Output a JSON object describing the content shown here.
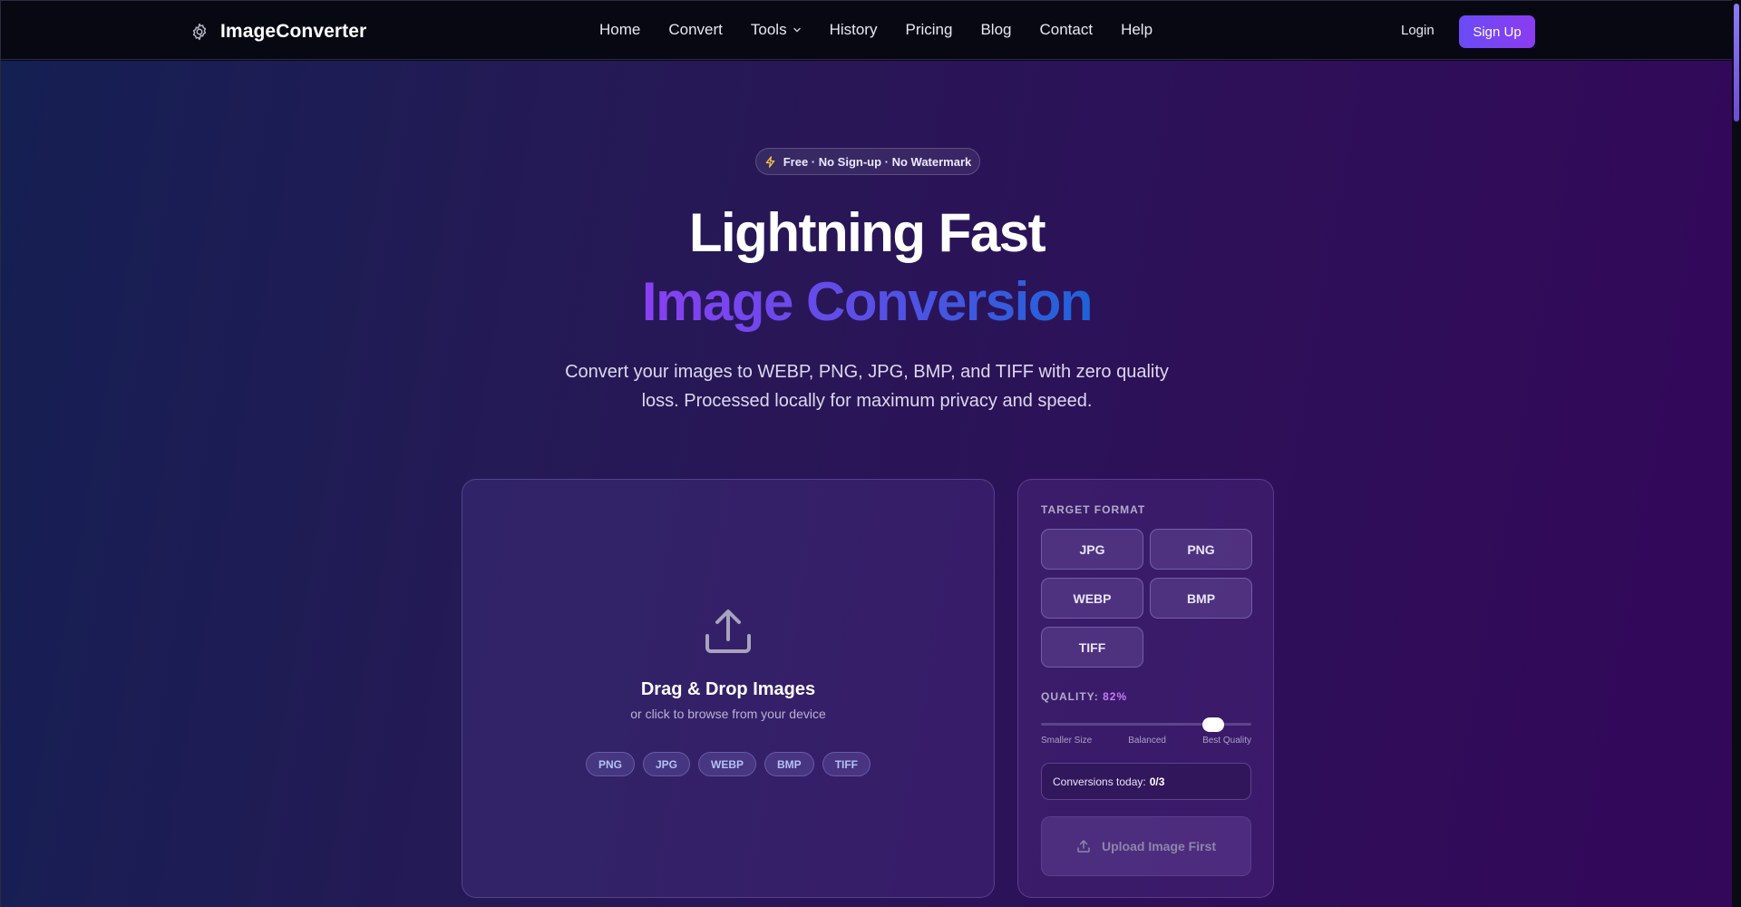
{
  "brand": {
    "name": "ImageConverter",
    "icon": "gear-icon"
  },
  "nav": {
    "links": [
      {
        "label": "Home"
      },
      {
        "label": "Convert"
      },
      {
        "label": "Tools",
        "dropdown": true
      },
      {
        "label": "History"
      },
      {
        "label": "Pricing"
      },
      {
        "label": "Blog"
      },
      {
        "label": "Contact"
      },
      {
        "label": "Help"
      }
    ],
    "login": "Login",
    "signup": "Sign Up"
  },
  "hero": {
    "badge": "Free · No Sign-up · No Watermark",
    "title_line1": "Lightning Fast",
    "title_line2": "Image Conversion",
    "subtitle": "Convert your images to WEBP, PNG, JPG, BMP, and TIFF with zero quality loss. Processed locally for maximum privacy and speed."
  },
  "dropzone": {
    "title": "Drag & Drop Images",
    "subtitle": "or click to browse from your device",
    "formats": [
      "PNG",
      "JPG",
      "WEBP",
      "BMP",
      "TIFF"
    ]
  },
  "panel": {
    "target_label": "TARGET FORMAT",
    "formats": [
      "JPG",
      "PNG",
      "WEBP",
      "BMP",
      "TIFF"
    ],
    "quality_label": "QUALITY:",
    "quality_value": "82%",
    "quality_fraction": 0.82,
    "slider_left": "Smaller Size",
    "slider_mid": "Balanced",
    "slider_right": "Best Quality",
    "conversions_label": "Conversions today:",
    "conversions_value": "0/3",
    "action_label": "Upload Image First"
  },
  "colors": {
    "accent": "#8b3cf0",
    "accent_blue": "#1e63d8",
    "quality_value": "#c57cf7",
    "pill_text": "#b3c2f5"
  }
}
